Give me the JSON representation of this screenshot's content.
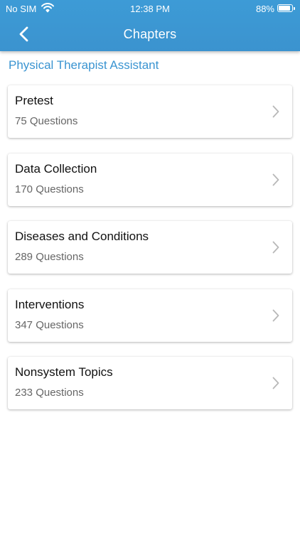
{
  "status_bar": {
    "carrier": "No SIM",
    "time": "12:38 PM",
    "battery": "88%",
    "battery_level": 0.88
  },
  "nav": {
    "title": "Chapters",
    "back_icon": "chevron-left-icon"
  },
  "section_title": "Physical Therapist Assistant",
  "chapters": [
    {
      "title": "Pretest",
      "subtitle": "75 Questions"
    },
    {
      "title": "Data Collection",
      "subtitle": "170 Questions"
    },
    {
      "title": "Diseases and Conditions",
      "subtitle": "289 Questions"
    },
    {
      "title": "Interventions",
      "subtitle": "347 Questions"
    },
    {
      "title": "Nonsystem Topics",
      "subtitle": "233 Questions"
    }
  ],
  "colors": {
    "header": "#3b93cf",
    "accent_text": "#3a94d1",
    "card_title": "#111111",
    "card_subtitle": "#666666",
    "chevron": "#b8b8b8"
  }
}
